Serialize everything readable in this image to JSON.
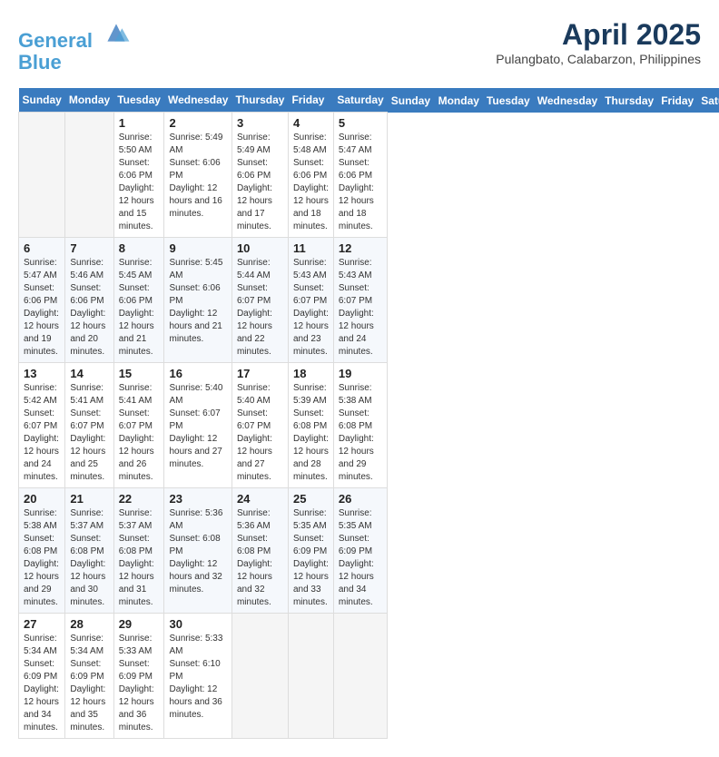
{
  "header": {
    "logo_line1": "General",
    "logo_line2": "Blue",
    "month_title": "April 2025",
    "subtitle": "Pulangbato, Calabarzon, Philippines"
  },
  "days_of_week": [
    "Sunday",
    "Monday",
    "Tuesday",
    "Wednesday",
    "Thursday",
    "Friday",
    "Saturday"
  ],
  "weeks": [
    [
      {
        "day": "",
        "info": ""
      },
      {
        "day": "",
        "info": ""
      },
      {
        "day": "1",
        "info": "Sunrise: 5:50 AM\nSunset: 6:06 PM\nDaylight: 12 hours and 15 minutes."
      },
      {
        "day": "2",
        "info": "Sunrise: 5:49 AM\nSunset: 6:06 PM\nDaylight: 12 hours and 16 minutes."
      },
      {
        "day": "3",
        "info": "Sunrise: 5:49 AM\nSunset: 6:06 PM\nDaylight: 12 hours and 17 minutes."
      },
      {
        "day": "4",
        "info": "Sunrise: 5:48 AM\nSunset: 6:06 PM\nDaylight: 12 hours and 18 minutes."
      },
      {
        "day": "5",
        "info": "Sunrise: 5:47 AM\nSunset: 6:06 PM\nDaylight: 12 hours and 18 minutes."
      }
    ],
    [
      {
        "day": "6",
        "info": "Sunrise: 5:47 AM\nSunset: 6:06 PM\nDaylight: 12 hours and 19 minutes."
      },
      {
        "day": "7",
        "info": "Sunrise: 5:46 AM\nSunset: 6:06 PM\nDaylight: 12 hours and 20 minutes."
      },
      {
        "day": "8",
        "info": "Sunrise: 5:45 AM\nSunset: 6:06 PM\nDaylight: 12 hours and 21 minutes."
      },
      {
        "day": "9",
        "info": "Sunrise: 5:45 AM\nSunset: 6:06 PM\nDaylight: 12 hours and 21 minutes."
      },
      {
        "day": "10",
        "info": "Sunrise: 5:44 AM\nSunset: 6:07 PM\nDaylight: 12 hours and 22 minutes."
      },
      {
        "day": "11",
        "info": "Sunrise: 5:43 AM\nSunset: 6:07 PM\nDaylight: 12 hours and 23 minutes."
      },
      {
        "day": "12",
        "info": "Sunrise: 5:43 AM\nSunset: 6:07 PM\nDaylight: 12 hours and 24 minutes."
      }
    ],
    [
      {
        "day": "13",
        "info": "Sunrise: 5:42 AM\nSunset: 6:07 PM\nDaylight: 12 hours and 24 minutes."
      },
      {
        "day": "14",
        "info": "Sunrise: 5:41 AM\nSunset: 6:07 PM\nDaylight: 12 hours and 25 minutes."
      },
      {
        "day": "15",
        "info": "Sunrise: 5:41 AM\nSunset: 6:07 PM\nDaylight: 12 hours and 26 minutes."
      },
      {
        "day": "16",
        "info": "Sunrise: 5:40 AM\nSunset: 6:07 PM\nDaylight: 12 hours and 27 minutes."
      },
      {
        "day": "17",
        "info": "Sunrise: 5:40 AM\nSunset: 6:07 PM\nDaylight: 12 hours and 27 minutes."
      },
      {
        "day": "18",
        "info": "Sunrise: 5:39 AM\nSunset: 6:08 PM\nDaylight: 12 hours and 28 minutes."
      },
      {
        "day": "19",
        "info": "Sunrise: 5:38 AM\nSunset: 6:08 PM\nDaylight: 12 hours and 29 minutes."
      }
    ],
    [
      {
        "day": "20",
        "info": "Sunrise: 5:38 AM\nSunset: 6:08 PM\nDaylight: 12 hours and 29 minutes."
      },
      {
        "day": "21",
        "info": "Sunrise: 5:37 AM\nSunset: 6:08 PM\nDaylight: 12 hours and 30 minutes."
      },
      {
        "day": "22",
        "info": "Sunrise: 5:37 AM\nSunset: 6:08 PM\nDaylight: 12 hours and 31 minutes."
      },
      {
        "day": "23",
        "info": "Sunrise: 5:36 AM\nSunset: 6:08 PM\nDaylight: 12 hours and 32 minutes."
      },
      {
        "day": "24",
        "info": "Sunrise: 5:36 AM\nSunset: 6:08 PM\nDaylight: 12 hours and 32 minutes."
      },
      {
        "day": "25",
        "info": "Sunrise: 5:35 AM\nSunset: 6:09 PM\nDaylight: 12 hours and 33 minutes."
      },
      {
        "day": "26",
        "info": "Sunrise: 5:35 AM\nSunset: 6:09 PM\nDaylight: 12 hours and 34 minutes."
      }
    ],
    [
      {
        "day": "27",
        "info": "Sunrise: 5:34 AM\nSunset: 6:09 PM\nDaylight: 12 hours and 34 minutes."
      },
      {
        "day": "28",
        "info": "Sunrise: 5:34 AM\nSunset: 6:09 PM\nDaylight: 12 hours and 35 minutes."
      },
      {
        "day": "29",
        "info": "Sunrise: 5:33 AM\nSunset: 6:09 PM\nDaylight: 12 hours and 36 minutes."
      },
      {
        "day": "30",
        "info": "Sunrise: 5:33 AM\nSunset: 6:10 PM\nDaylight: 12 hours and 36 minutes."
      },
      {
        "day": "",
        "info": ""
      },
      {
        "day": "",
        "info": ""
      },
      {
        "day": "",
        "info": ""
      }
    ]
  ]
}
